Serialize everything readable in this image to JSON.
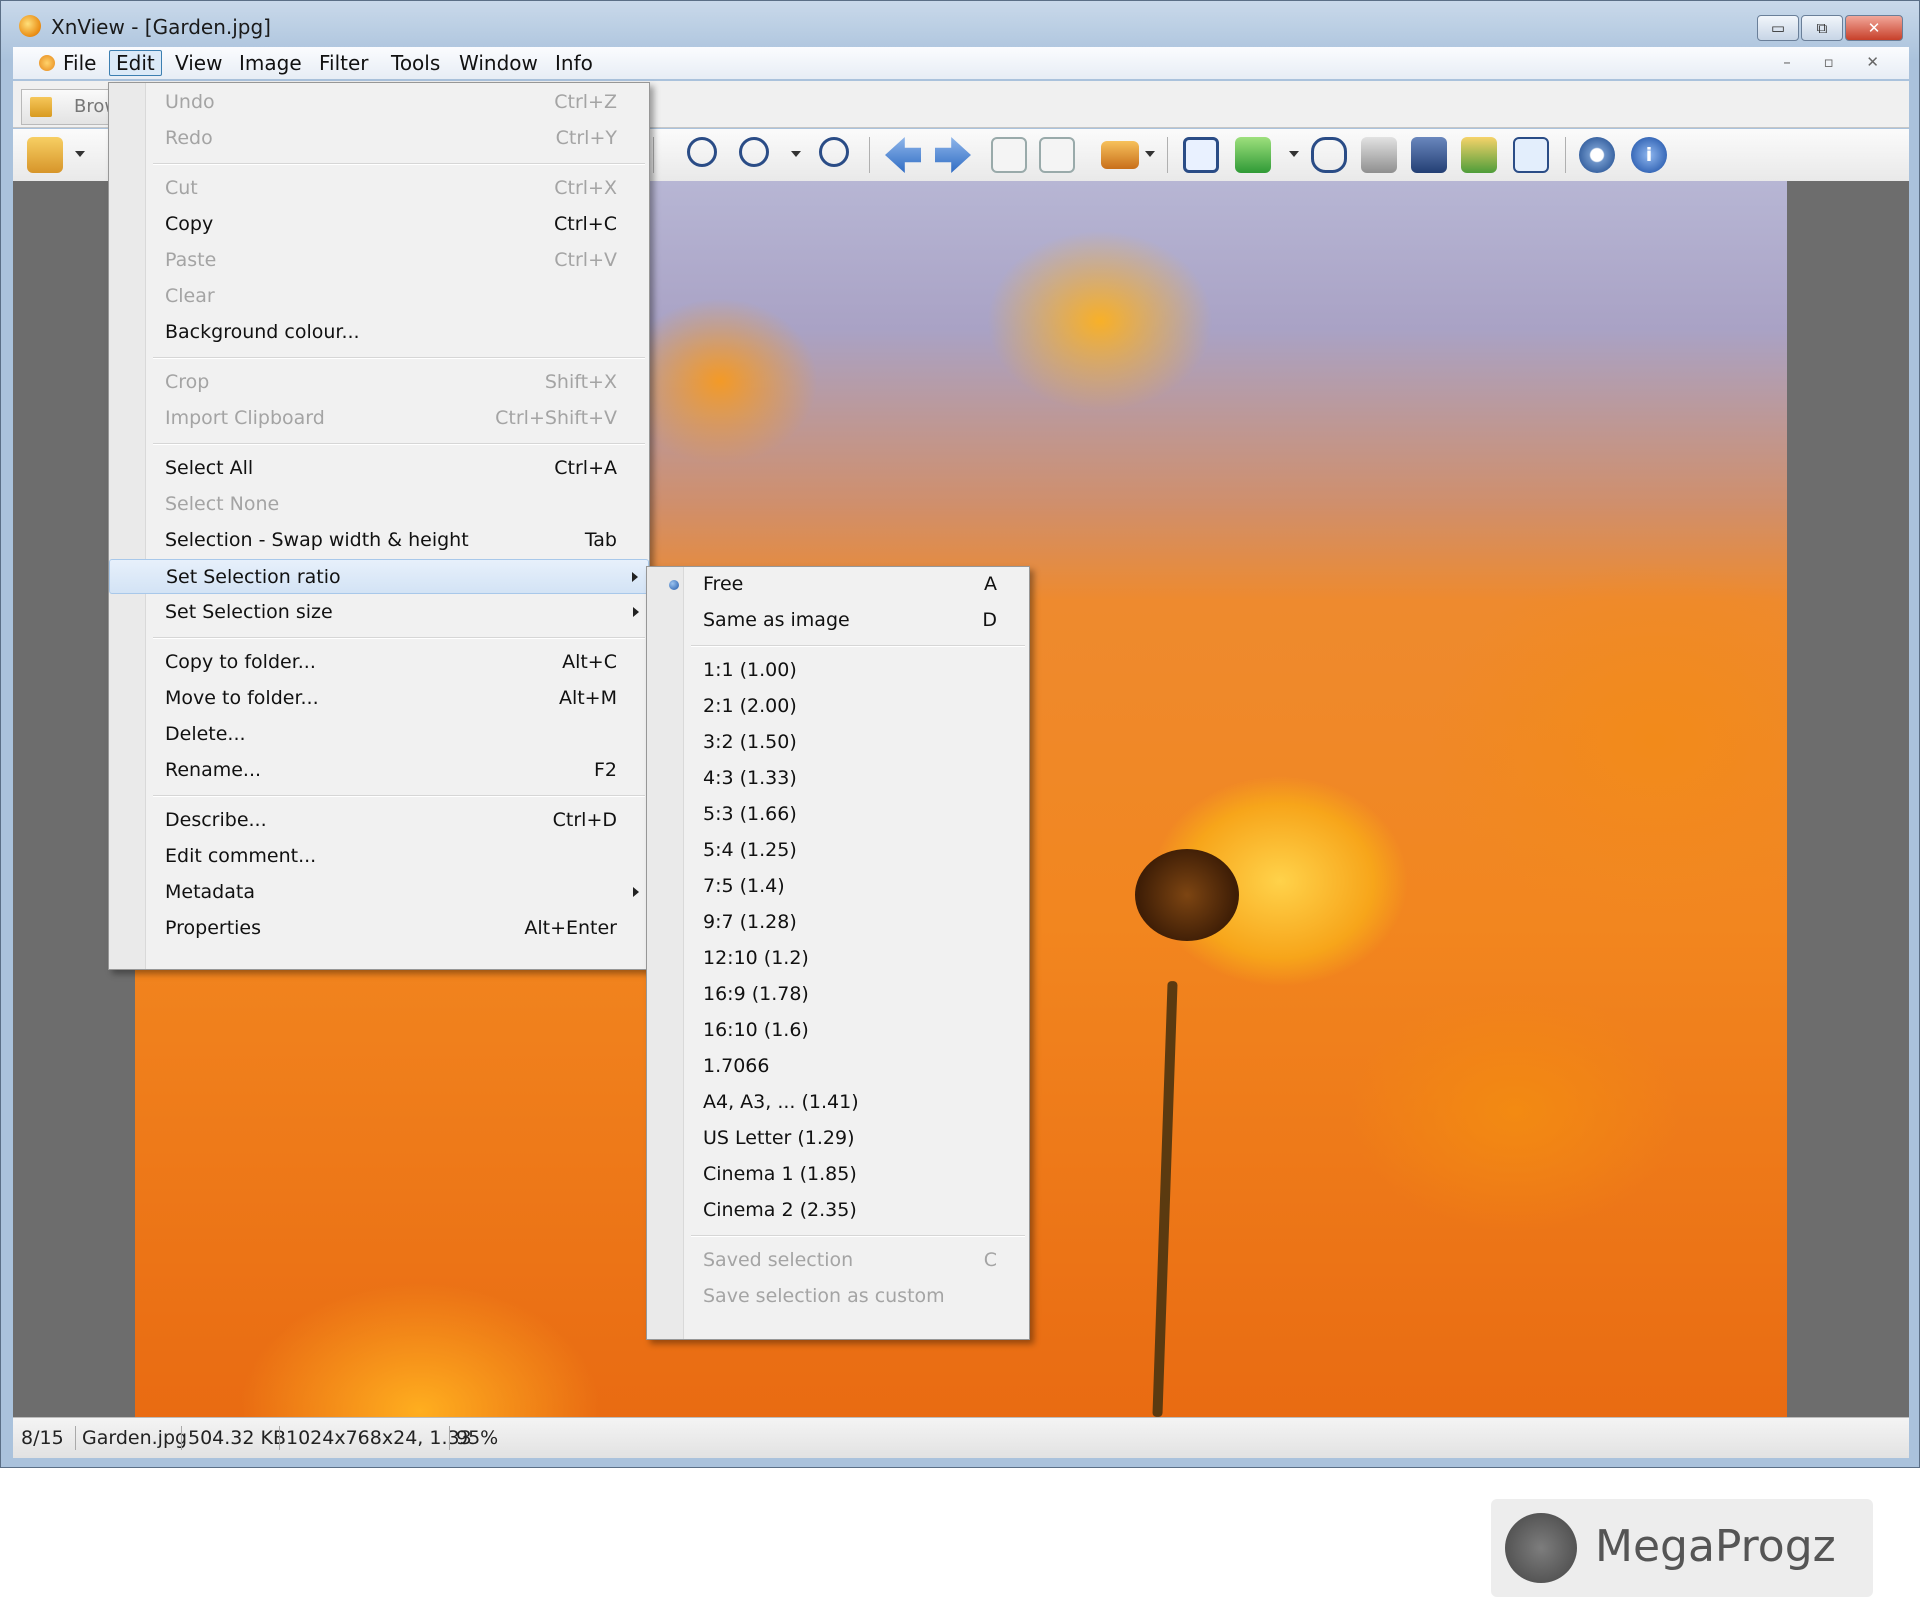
{
  "window": {
    "title": "XnView - [Garden.jpg]",
    "min": "▭",
    "max": "⧉",
    "close": "✕"
  },
  "menubar": [
    "File",
    "Edit",
    "View",
    "Image",
    "Filter",
    "Tools",
    "Window",
    "Info"
  ],
  "mdi_buttons": "– ▫ ✕",
  "tab": {
    "label": "Brow"
  },
  "edit_menu": {
    "undo": {
      "label": "Undo",
      "shortcut": "Ctrl+Z"
    },
    "redo": {
      "label": "Redo",
      "shortcut": "Ctrl+Y"
    },
    "cut": {
      "label": "Cut",
      "shortcut": "Ctrl+X"
    },
    "copy": {
      "label": "Copy",
      "shortcut": "Ctrl+C"
    },
    "paste": {
      "label": "Paste",
      "shortcut": "Ctrl+V"
    },
    "clear": {
      "label": "Clear",
      "shortcut": ""
    },
    "background_colour": {
      "label": "Background colour...",
      "shortcut": ""
    },
    "crop": {
      "label": "Crop",
      "shortcut": "Shift+X"
    },
    "import_clipboard": {
      "label": "Import Clipboard",
      "shortcut": "Ctrl+Shift+V"
    },
    "select_all": {
      "label": "Select All",
      "shortcut": "Ctrl+A"
    },
    "select_none": {
      "label": "Select None",
      "shortcut": ""
    },
    "swap": {
      "label": "Selection - Swap width & height",
      "shortcut": "Tab"
    },
    "set_ratio": {
      "label": "Set Selection ratio",
      "shortcut": ""
    },
    "set_size": {
      "label": "Set Selection size",
      "shortcut": ""
    },
    "copy_to_folder": {
      "label": "Copy to folder...",
      "shortcut": "Alt+C"
    },
    "move_to_folder": {
      "label": "Move to folder...",
      "shortcut": "Alt+M"
    },
    "delete": {
      "label": "Delete...",
      "shortcut": ""
    },
    "rename": {
      "label": "Rename...",
      "shortcut": "F2"
    },
    "describe": {
      "label": "Describe...",
      "shortcut": "Ctrl+D"
    },
    "edit_comment": {
      "label": "Edit comment...",
      "shortcut": ""
    },
    "metadata": {
      "label": "Metadata",
      "shortcut": ""
    },
    "properties": {
      "label": "Properties",
      "shortcut": "Alt+Enter"
    }
  },
  "ratio_menu": {
    "free": {
      "label": "Free",
      "shortcut": "A"
    },
    "same_as_image": {
      "label": "Same as image",
      "shortcut": "D"
    },
    "r1_1": "1:1 (1.00)",
    "r2_1": "2:1 (2.00)",
    "r3_2": "3:2 (1.50)",
    "r4_3": "4:3 (1.33)",
    "r5_3": "5:3 (1.66)",
    "r5_4": "5:4 (1.25)",
    "r7_5": "7:5 (1.4)",
    "r9_7": "9:7 (1.28)",
    "r12_10": "12:10 (1.2)",
    "r16_9": "16:9 (1.78)",
    "r16_10": "16:10 (1.6)",
    "r17066": "1.7066",
    "a4": "A4, A3, ... (1.41)",
    "us_letter": "US Letter (1.29)",
    "cinema1": "Cinema 1 (1.85)",
    "cinema2": "Cinema 2 (2.35)",
    "saved_selection": {
      "label": "Saved selection",
      "shortcut": "C"
    },
    "save_custom": "Save selection as custom"
  },
  "watermark": "MegaProgz",
  "status": [
    "8/15",
    "Garden.jpg",
    "504.32 KB",
    "1024x768x24, 1.33",
    "95%"
  ]
}
